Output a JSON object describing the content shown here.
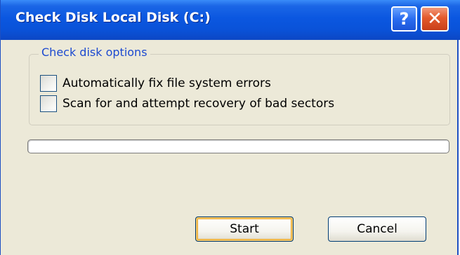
{
  "window": {
    "title": "Check Disk Local Disk (C:)",
    "help_glyph": "?",
    "close_glyph": "✕"
  },
  "options_group": {
    "legend": "Check disk options",
    "options": [
      {
        "label": "Automatically fix file system errors",
        "checked": false
      },
      {
        "label": "Scan for and attempt recovery of bad sectors",
        "checked": false
      }
    ]
  },
  "progress": {
    "value_percent": 0
  },
  "buttons": {
    "start_label": "Start",
    "cancel_label": "Cancel"
  },
  "colors": {
    "titlebar_blue": "#0a52d8",
    "dialog_face": "#ece9d8",
    "legend_blue": "#1d4ad0",
    "close_red": "#e35a2c"
  },
  "icons": {
    "help": "help-icon",
    "close": "close-icon"
  }
}
